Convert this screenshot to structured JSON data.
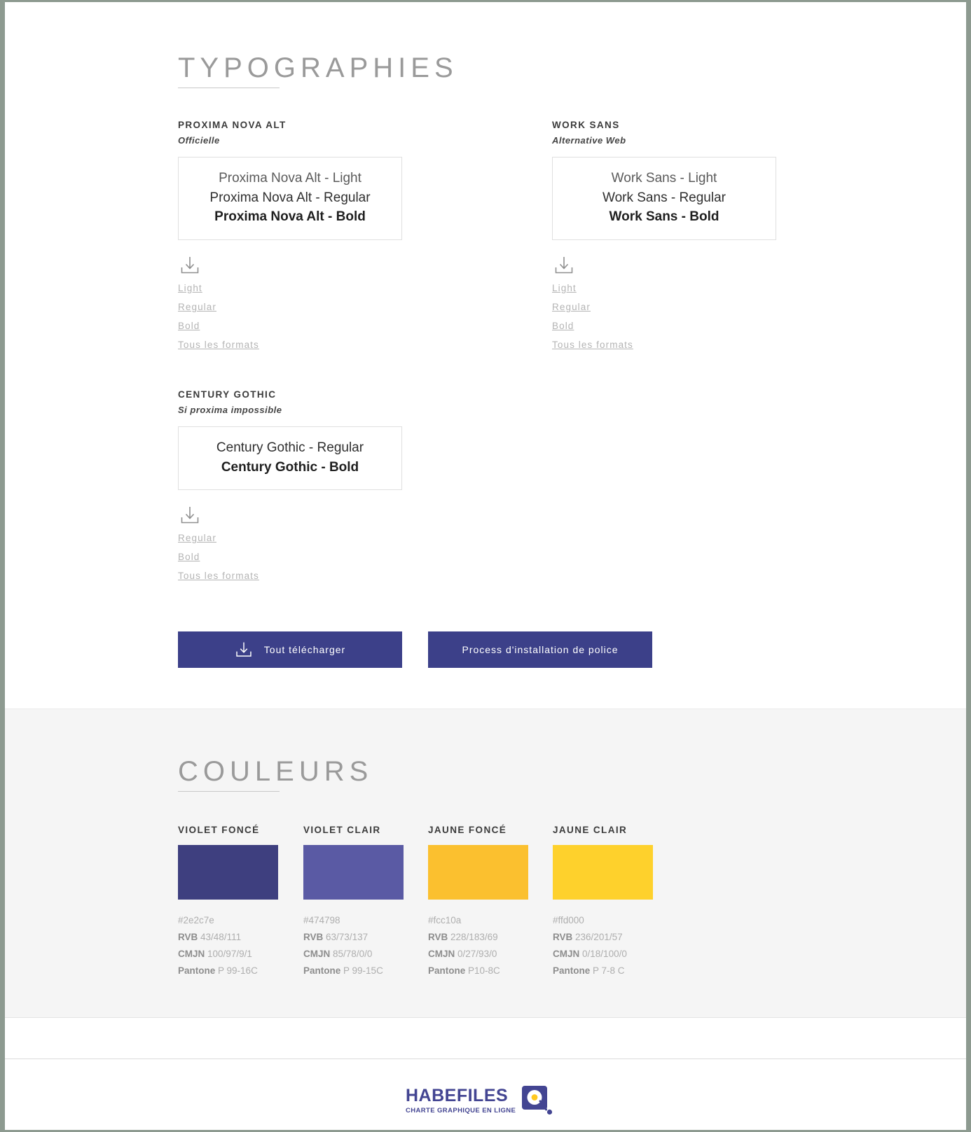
{
  "sections": {
    "typographies": {
      "title": "TYPOGRAPHIES"
    },
    "couleurs": {
      "title": "COULEURS"
    }
  },
  "fonts": [
    {
      "name": "PROXIMA NOVA ALT",
      "subtitle": "Officielle",
      "specimen": [
        "Proxima Nova Alt - Light",
        "Proxima Nova Alt - Regular",
        "Proxima Nova Alt - Bold"
      ],
      "download_icon": "download-icon",
      "links": [
        "Light",
        "Regular",
        "Bold",
        "Tous les formats"
      ]
    },
    {
      "name": "WORK SANS",
      "subtitle": "Alternative Web",
      "specimen": [
        "Work Sans - Light",
        "Work Sans - Regular",
        "Work Sans - Bold"
      ],
      "download_icon": "download-icon",
      "links": [
        "Light",
        "Regular",
        "Bold",
        "Tous les formats"
      ]
    },
    {
      "name": "CENTURY GOTHIC",
      "subtitle": "Si proxima impossible",
      "specimen": [
        "Century Gothic - Regular",
        "Century Gothic - Bold"
      ],
      "download_icon": "download-icon",
      "links": [
        "Regular",
        "Bold",
        "Tous les formats"
      ]
    }
  ],
  "buttons": {
    "download_all": {
      "label": "Tout télécharger",
      "icon": "download-icon",
      "color": "#3c4089"
    },
    "install_process": {
      "label": "Process d'installation de police",
      "color": "#3c4089"
    }
  },
  "colors": [
    {
      "name": "VIOLET FONCÉ",
      "hex": "#2e2c7e",
      "swatch": "#3e3f7f",
      "rvb_label": "RVB",
      "rvb": "43/48/111",
      "cmjn_label": "CMJN",
      "cmjn": "100/97/9/1",
      "pantone_label": "Pantone",
      "pantone": "P 99-16C"
    },
    {
      "name": "VIOLET CLAIR",
      "hex": "#474798",
      "swatch": "#5a5aa4",
      "rvb_label": "RVB",
      "rvb": "63/73/137",
      "cmjn_label": "CMJN",
      "cmjn": "85/78/0/0",
      "pantone_label": "Pantone",
      "pantone": "P 99-15C"
    },
    {
      "name": "JAUNE FONCÉ",
      "hex": "#fcc10a",
      "swatch": "#fbc02f",
      "rvb_label": "RVB",
      "rvb": "228/183/69",
      "cmjn_label": "CMJN",
      "cmjn": "0/27/93/0",
      "pantone_label": "Pantone",
      "pantone": "P10-8C"
    },
    {
      "name": "JAUNE CLAIR",
      "hex": "#ffd000",
      "swatch": "#fed12c",
      "rvb_label": "RVB",
      "rvb": "236/201/57",
      "cmjn_label": "CMJN",
      "cmjn": "0/18/100/0",
      "pantone_label": "Pantone",
      "pantone": "P 7-8 C"
    }
  ],
  "footer": {
    "logo_word": "HABEFILES",
    "logo_tagline": "CHARTE GRAPHIQUE EN LIGNE",
    "logo_mark": "habefiles-logo-mark",
    "brand_color": "#434592",
    "accent_color": "#ffc820"
  }
}
